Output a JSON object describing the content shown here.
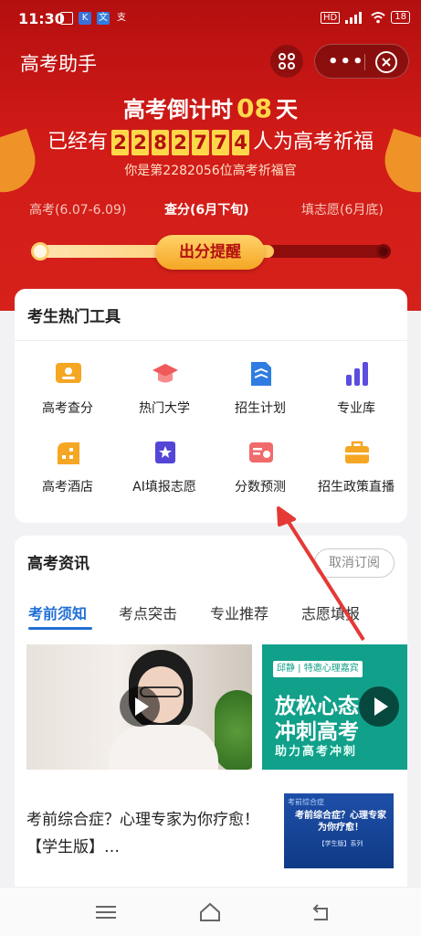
{
  "status_bar": {
    "time": "11:30",
    "app_icons": [
      "K",
      "文",
      "支"
    ],
    "battery": "18"
  },
  "app_bar": {
    "title": "高考助手",
    "more_label": "•••"
  },
  "hero": {
    "countdown_prefix": "高考倒计时",
    "countdown_days": "08",
    "countdown_suffix": "天",
    "blessing_prefix": "已经有",
    "blessing_digits": [
      "2",
      "2",
      "8",
      "2",
      "7",
      "7",
      "4"
    ],
    "blessing_suffix": "人为高考祈福",
    "rank_text": "你是第2282056位高考祈福官",
    "stages": [
      {
        "label": "高考(6.07-6.09)"
      },
      {
        "label": "查分(6月下旬)"
      },
      {
        "label": "填志愿(6月底)"
      }
    ],
    "active_stage": 1,
    "progress_fraction": 0.68,
    "remind_button": "出分提醒"
  },
  "tools": {
    "title": "考生热门工具",
    "items": [
      {
        "label": "高考查分",
        "icon": "score-card-icon",
        "color": "#f5a623"
      },
      {
        "label": "热门大学",
        "icon": "graduation-cap-icon",
        "color": "#f05a5a"
      },
      {
        "label": "招生计划",
        "icon": "plan-document-icon",
        "color": "#2f7de1"
      },
      {
        "label": "专业库",
        "icon": "bar-chart-icon",
        "color": "#5a4de0"
      },
      {
        "label": "高考酒店",
        "icon": "hotel-building-icon",
        "color": "#f5a623"
      },
      {
        "label": "AI填报志愿",
        "icon": "ai-scroll-icon",
        "color": "#5346d6"
      },
      {
        "label": "分数预测",
        "icon": "prediction-certificate-icon",
        "color": "#f06b6b"
      },
      {
        "label": "招生政策直播",
        "icon": "briefcase-icon",
        "color": "#f5a623"
      }
    ]
  },
  "news": {
    "title": "高考资讯",
    "unsubscribe": "取消订阅",
    "tabs": [
      {
        "label": "考前须知"
      },
      {
        "label": "考点突击"
      },
      {
        "label": "专业推荐"
      },
      {
        "label": "志愿填报"
      }
    ],
    "video2": {
      "tag": "邱静 | 特邀心理嘉宾",
      "line1": "放松心态",
      "line2": "冲刺高考",
      "line3": "助力高考冲刺"
    },
    "article": {
      "title": "考前综合症？心理专家为你疗愈！【学生版】…",
      "thumb_header": "考前综合症",
      "thumb_title": "考前综合症？心理专家为你疗愈！",
      "thumb_sub": "【学生版】系列"
    }
  },
  "colors": {
    "hero_red": "#d11b17",
    "gold": "#ffd84a",
    "accent_blue": "#1f6fd6",
    "annotation_arrow": "#e53935"
  }
}
